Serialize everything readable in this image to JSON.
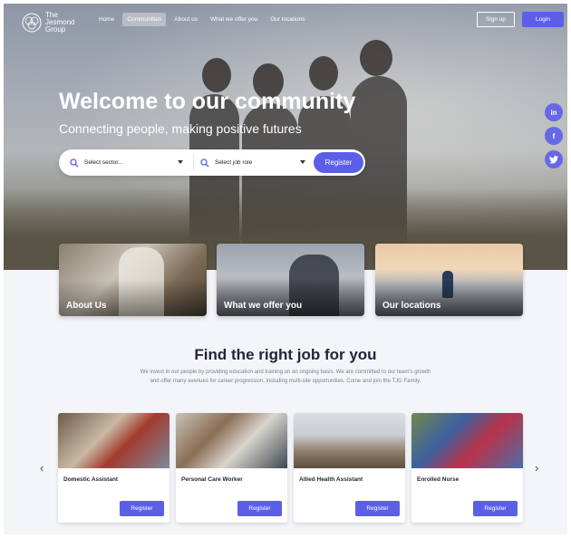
{
  "header": {
    "logo_text": "The Jesmond Group",
    "nav": [
      "Home",
      "Communities",
      "About us",
      "What we offer you",
      "Our locations"
    ],
    "active_nav": "Communities",
    "signup_label": "Sign up",
    "login_label": "Login"
  },
  "hero": {
    "title": "Welcome to our community",
    "subtitle": "Connecting people, making positive futures",
    "sector_placeholder": "Select sector...",
    "role_placeholder": "Select job role",
    "register_label": "Register"
  },
  "social": [
    "linkedin-icon",
    "facebook-icon",
    "twitter-icon"
  ],
  "features": [
    {
      "label": "About Us"
    },
    {
      "label": "What we offer you"
    },
    {
      "label": "Our locations"
    }
  ],
  "find_job": {
    "title": "Find the right job for you",
    "description": "We invest in our people by providing education and training on an ongoing basis. We are committed to our team's growth and offer many avenues for career progression, including multi-site opportunities. Come and join the TJG Family."
  },
  "jobs": [
    {
      "title": "Domestic Assistant",
      "register_label": "Register"
    },
    {
      "title": "Personal Care Worker",
      "register_label": "Register"
    },
    {
      "title": "Allied Health Assistant",
      "register_label": "Register"
    },
    {
      "title": "Enrolled Nurse",
      "register_label": "Register"
    }
  ],
  "colors": {
    "accent": "#5b5fe8",
    "heading": "#22263b",
    "muted": "#7a7e8c"
  }
}
